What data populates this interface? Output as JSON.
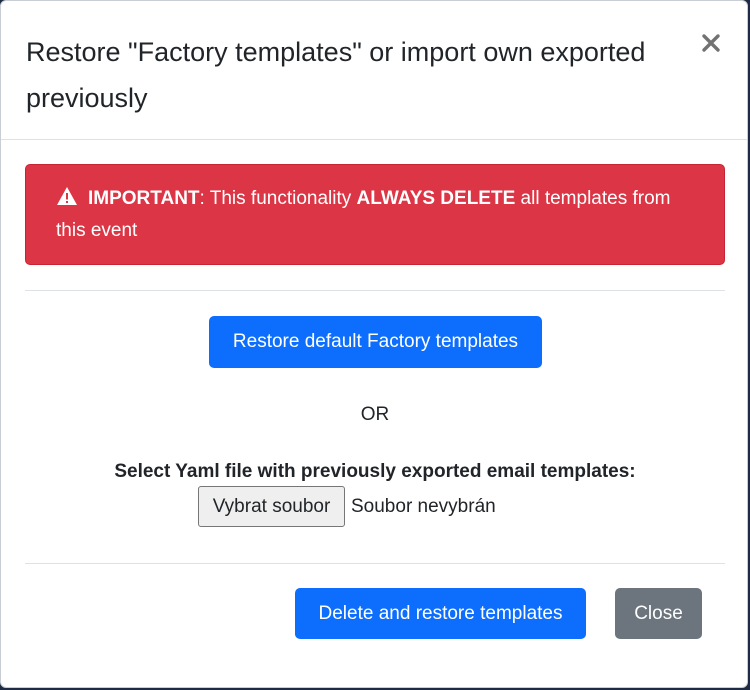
{
  "modal": {
    "title": "Restore \"Factory templates\" or import own exported previously",
    "close_icon": "close-icon"
  },
  "alert": {
    "icon": "warning-icon",
    "label_important": "IMPORTANT",
    "text_before": ": This functionality ",
    "label_always_delete": "ALWAYS DELETE",
    "text_after": " all templates from this event",
    "color": "#dc3545"
  },
  "actions": {
    "restore_default_label": "Restore default Factory templates",
    "or_text": "OR",
    "file_label": "Select Yaml file with previously exported email templates:",
    "file_button_label": "Vybrat soubor",
    "file_status": "Soubor nevybrán"
  },
  "footer": {
    "delete_restore_label": "Delete and restore templates",
    "close_label": "Close"
  },
  "colors": {
    "primary": "#0d6efd",
    "secondary": "#6c757d",
    "danger": "#dc3545"
  }
}
